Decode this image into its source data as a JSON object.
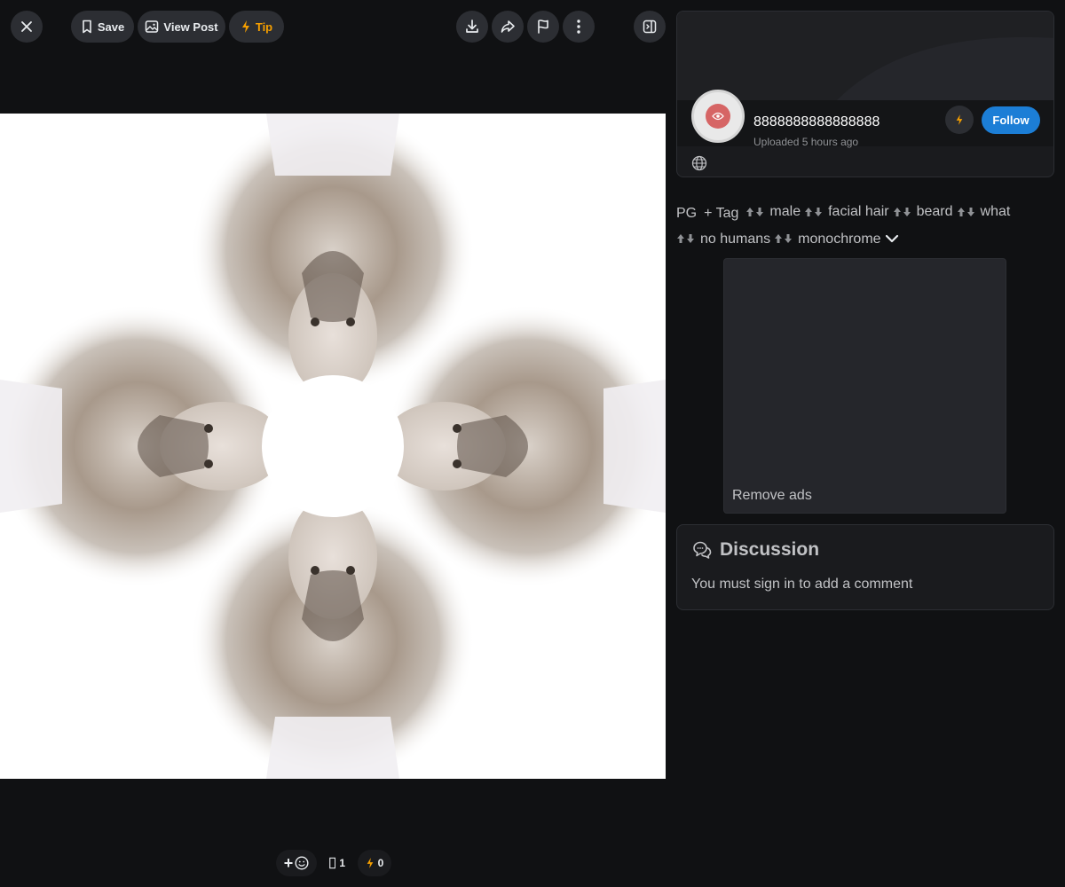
{
  "toolbar": {
    "save_label": "Save",
    "view_post_label": "View Post",
    "tip_label": "Tip"
  },
  "reactions": {
    "add_reaction": "+",
    "image_count": "1",
    "tip_count": "0"
  },
  "creator": {
    "username": "8888888888888888",
    "uploaded": "Uploaded 5 hours ago",
    "follow_label": "Follow"
  },
  "tags": {
    "rating": "PG",
    "add_label": "+ Tag",
    "items": [
      "male",
      "facial hair",
      "beard",
      "what",
      "no humans",
      "monochrome"
    ]
  },
  "ad": {
    "remove_label": "Remove ads"
  },
  "discussion": {
    "title": "Discussion",
    "message": "You must sign in to add a comment"
  },
  "colors": {
    "accent": "#1c7ed6",
    "tip": "#f59f00",
    "background": "#101113",
    "panel": "#1a1b1e"
  }
}
